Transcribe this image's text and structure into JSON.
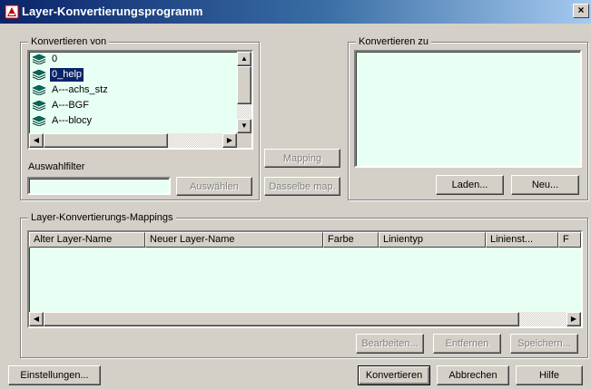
{
  "window": {
    "title": "Layer-Konvertierungsprogramm",
    "close_glyph": "×"
  },
  "convert_from": {
    "legend": "Konvertieren von",
    "layers": [
      {
        "name": "0",
        "selected": false
      },
      {
        "name": "0_help",
        "selected": true
      },
      {
        "name": "A---achs_stz",
        "selected": false
      },
      {
        "name": "A---BGF",
        "selected": false
      },
      {
        "name": "A---blocy",
        "selected": false
      }
    ],
    "filter_label": "Auswahlfilter",
    "filter_value": "",
    "select_button": "Auswählen"
  },
  "middle_buttons": {
    "mapping": "Mapping",
    "same_map": "Dasselbe map."
  },
  "convert_to": {
    "legend": "Konvertieren zu",
    "load_button": "Laden...",
    "new_button": "Neu..."
  },
  "mappings": {
    "legend": "Layer-Konvertierungs-Mappings",
    "columns": [
      "Alter Layer-Name",
      "Neuer Layer-Name",
      "Farbe",
      "Linientyp",
      "Linienst...",
      "F"
    ],
    "edit_button": "Bearbeiten...",
    "remove_button": "Entfernen",
    "save_button": "Speichern..."
  },
  "footer": {
    "settings_button": "Einstellungen...",
    "convert_button": "Konvertieren",
    "cancel_button": "Abbrechen",
    "help_button": "Hilfe"
  },
  "icons": {
    "app": "layer-app-icon",
    "layer": "layer-stack-icon",
    "arrow_up": "▲",
    "arrow_down": "▼",
    "arrow_left": "◀",
    "arrow_right": "▶"
  },
  "colors": {
    "titlebar_start": "#0a246a",
    "titlebar_end": "#a6caf0",
    "list_background": "#e8fff4",
    "selection": "#0a246a",
    "layer_icon": "#006b5a"
  }
}
